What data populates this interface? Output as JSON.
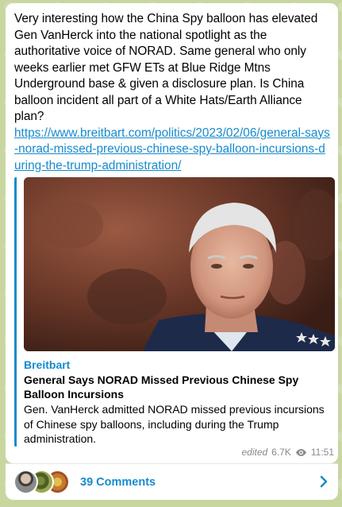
{
  "post": {
    "text": "Very interesting how the China Spy balloon has elevated Gen VanHerck into the national spotlight as the authoritative voice of NORAD. Same general who only weeks earlier met GFW ETs at Blue Ridge Mtns Underground base & given a disclosure plan. Is China balloon incident all part of a White Hats/Earth Alliance plan?",
    "link": "https://www.breitbart.com/politics/2023/02/06/general-says-norad-missed-previous-chinese-spy-balloon-incursions-during-the-trump-administration/"
  },
  "preview": {
    "site_name": "Breitbart",
    "title": "General Says NORAD Missed Previous Chinese Spy Balloon Incursions",
    "description": "Gen. VanHerck admitted NORAD missed previous incursions of Chinese spy balloons, including during the Trump administration.",
    "image_icon": "general-photo"
  },
  "meta": {
    "edited_label": "edited",
    "views": "6.7K",
    "time": "11:51"
  },
  "comments": {
    "label": "39 Comments",
    "avatars": [
      "avatar-person",
      "avatar-green",
      "avatar-yellow"
    ]
  },
  "colors": {
    "accent": "#168acd",
    "bubble": "#ffffff",
    "background": "#c8d6a0"
  }
}
